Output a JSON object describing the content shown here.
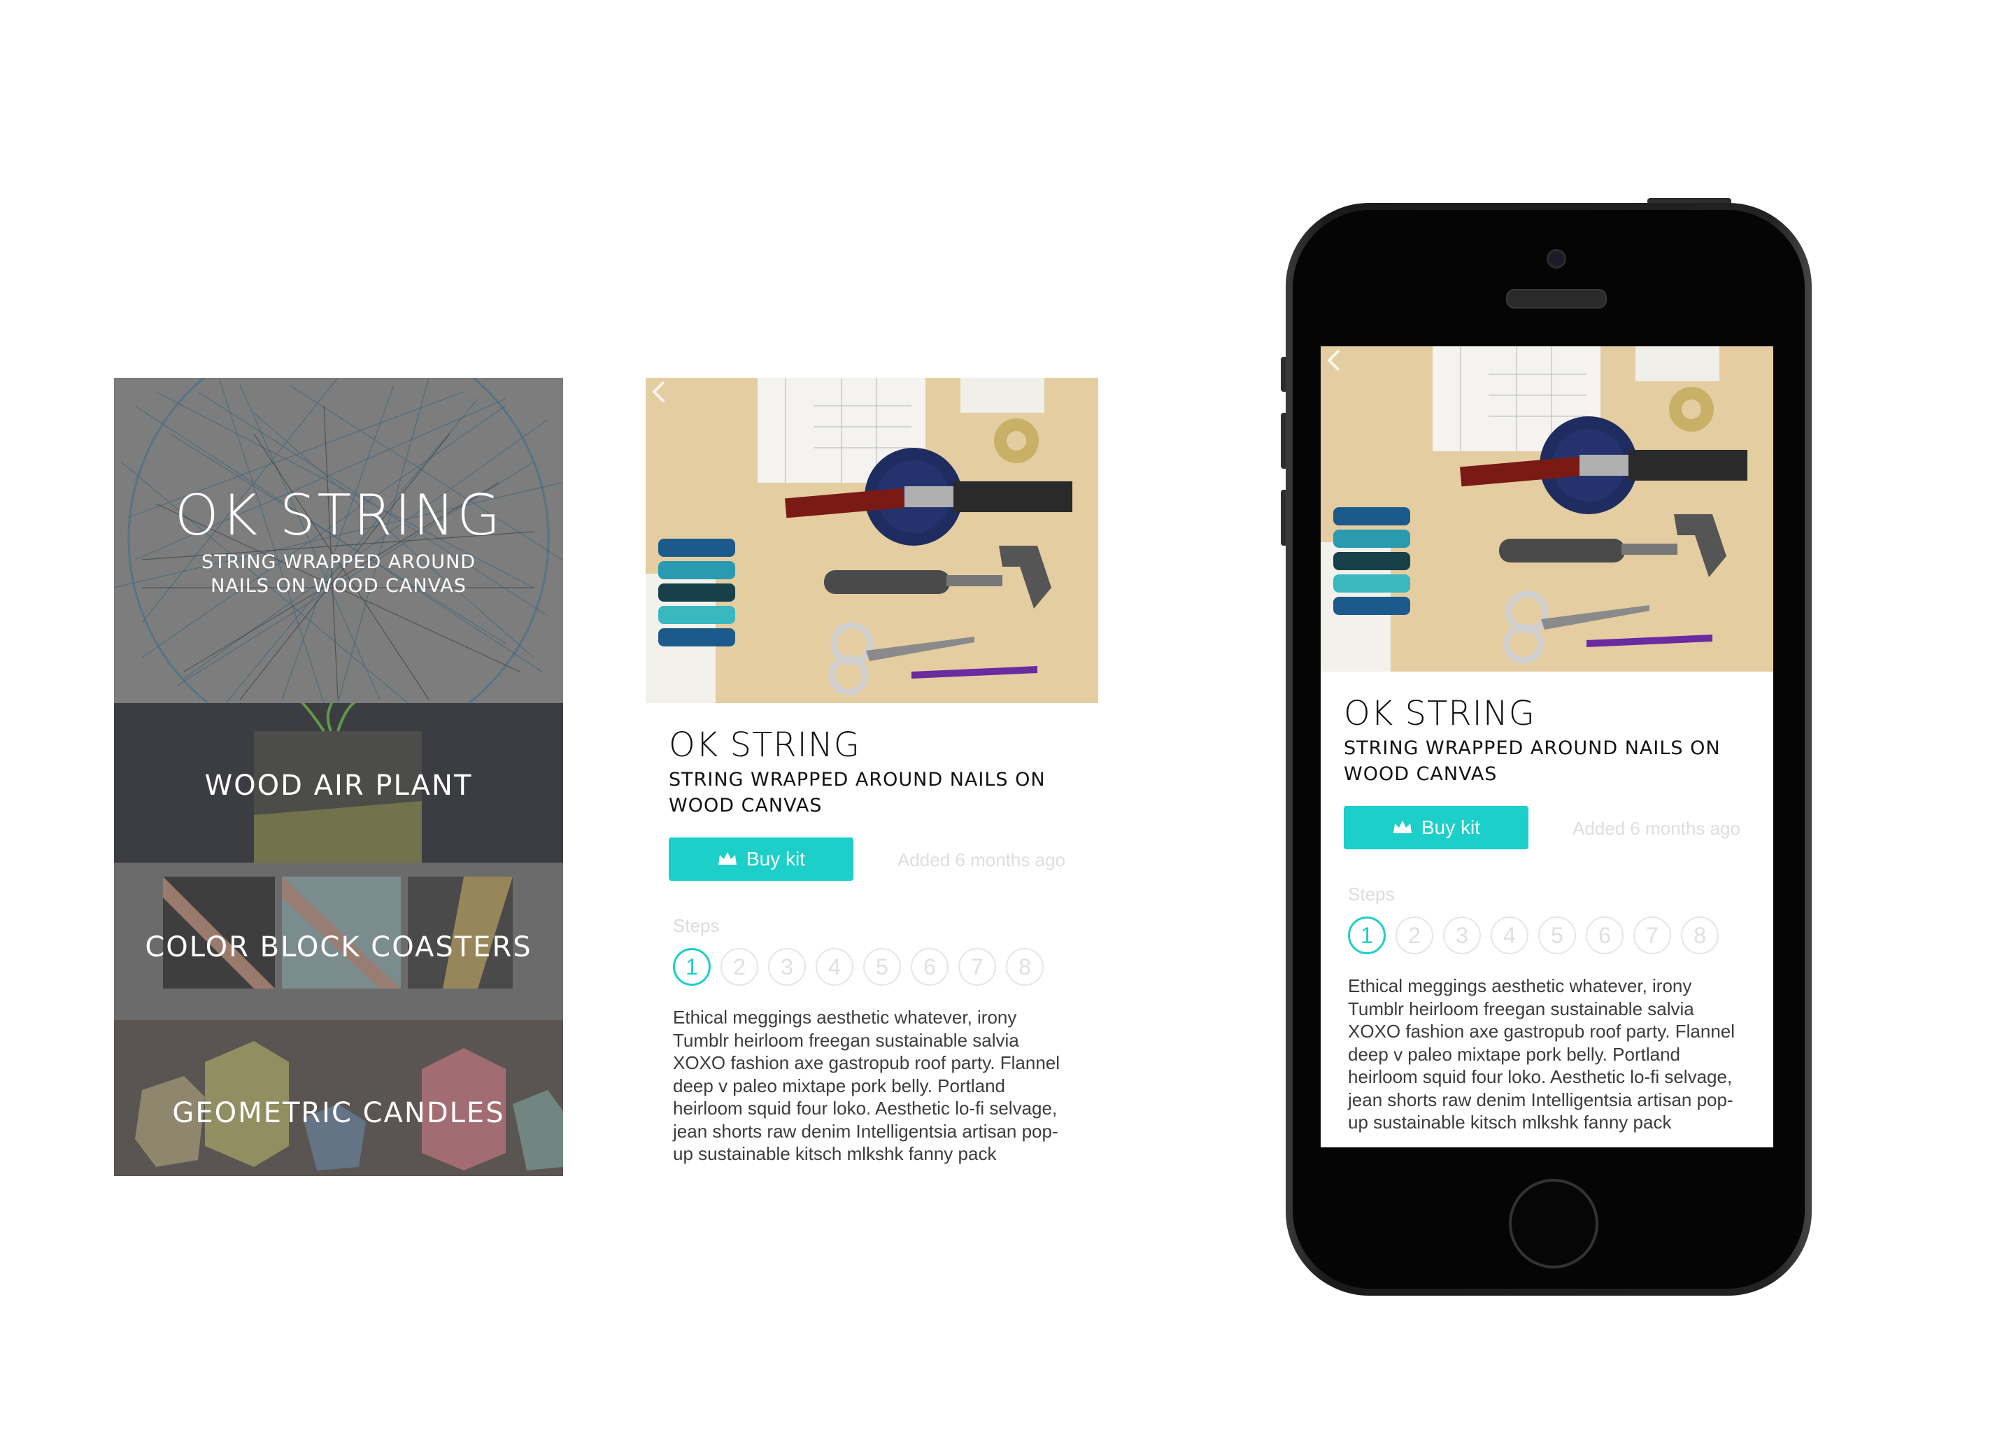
{
  "list_screen": {
    "hero": {
      "title": "OK STRING",
      "subtitle": "STRING WRAPPED AROUND NAILS ON WOOD CANVAS"
    },
    "items": [
      {
        "label": "WOOD AIR PLANT"
      },
      {
        "label": "COLOR BLOCK COASTERS"
      },
      {
        "label": "GEOMETRIC CANDLES"
      }
    ]
  },
  "detail": {
    "title": "OK STRING",
    "subtitle": "STRING WRAPPED AROUND NAILS ON WOOD CANVAS",
    "buy_label": "Buy kit",
    "added": "Added 6 months ago",
    "steps_label": "Steps",
    "steps": [
      "1",
      "2",
      "3",
      "4",
      "5",
      "6",
      "7",
      "8"
    ],
    "active_step": "1",
    "description": "Ethical meggings aesthetic whatever, irony Tumblr heirloom freegan sustainable salvia XOXO fashion axe gastropub roof party. Flannel deep v paleo mixtape pork belly. Portland heirloom squid four loko. Aesthetic lo-fi selvage, jean shorts raw denim Intelligentsia artisan pop-up sustainable kitsch mlkshk fanny pack"
  },
  "colors": {
    "accent": "#1ccfc9",
    "muted_text": "#dedede",
    "body_text": "#3c3c3c"
  },
  "icons": {
    "back": "chevron-left-icon",
    "buy": "crown-icon"
  }
}
